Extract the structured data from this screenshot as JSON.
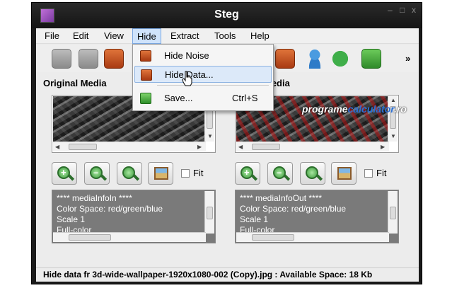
{
  "window": {
    "title": "Steg",
    "controls": {
      "minimize": "–",
      "maximize": "□",
      "close": "x"
    },
    "app_icon": "steg-app-icon"
  },
  "menubar": {
    "items": [
      {
        "label": "File"
      },
      {
        "label": "Edit"
      },
      {
        "label": "View"
      },
      {
        "label": "Hide"
      },
      {
        "label": "Extract"
      },
      {
        "label": "Tools"
      },
      {
        "label": "Help"
      }
    ]
  },
  "toolbar": {
    "overflow": "»"
  },
  "hide_menu": {
    "items": [
      {
        "label": "Hide Noise",
        "shortcut": ""
      },
      {
        "label": "Hide Data...",
        "shortcut": ""
      },
      {
        "label": "Save...",
        "shortcut": "Ctrl+S"
      }
    ]
  },
  "left_panel": {
    "heading": "Original Media",
    "fit_label": "Fit",
    "info_lines": [
      "**** mediaInfoIn ****",
      "Color Space: red/green/blue",
      "Scale 1",
      "Full-color"
    ]
  },
  "right_panel": {
    "heading": "Media",
    "fit_label": "Fit",
    "info_lines": [
      "**** mediaInfoOut ****",
      "Color Space: red/green/blue",
      "Scale 1",
      "Full-color"
    ]
  },
  "watermark": {
    "part1": "programe",
    "part2": "calculator",
    "part3": ".ro"
  },
  "statusbar": {
    "text": "Hide data fr 3d-wide-wallpaper-1920x1080-002 (Copy).jpg : Available Space: 18 Kb"
  },
  "colors": {
    "menu_highlight": "#cfe3fb",
    "info_box_bg": "#7a7a7a",
    "title_bar": "#1a1a1a",
    "zoom_green": "#3b9a3b",
    "watermark_blue": "#2a6fd6"
  }
}
